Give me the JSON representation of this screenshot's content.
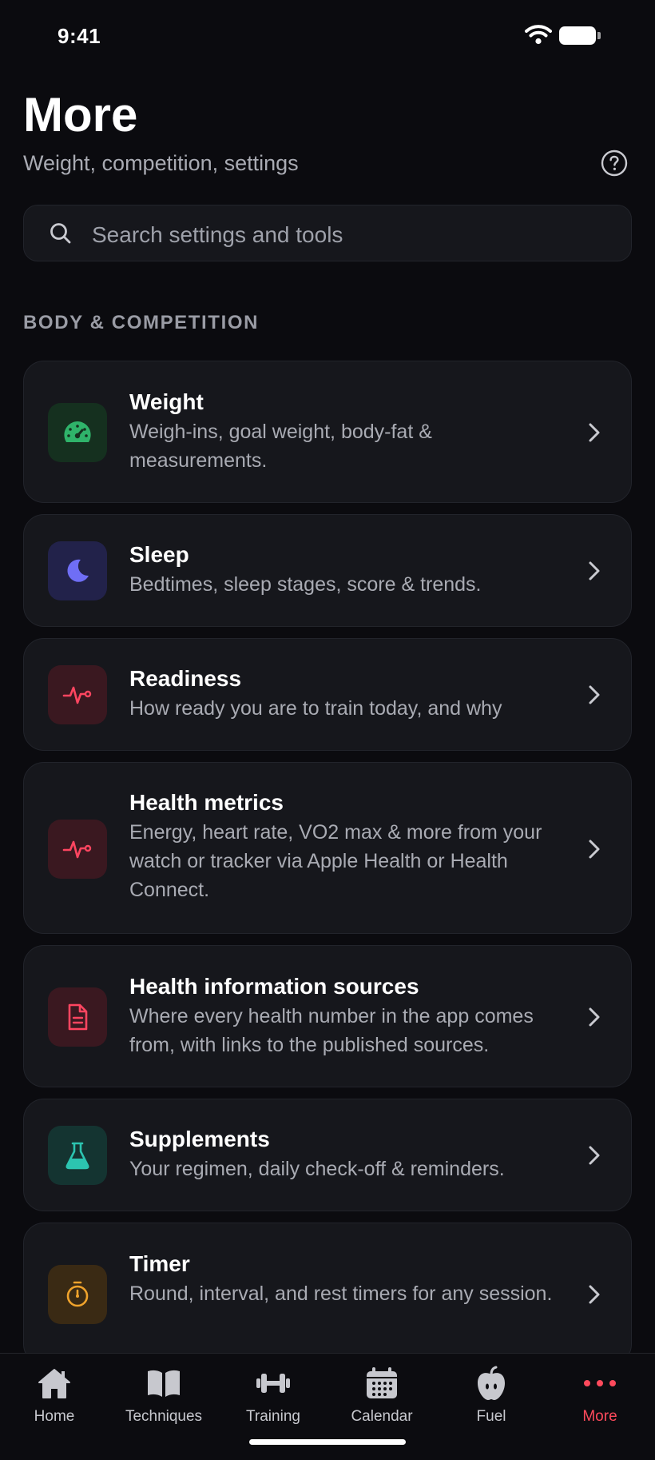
{
  "status_bar": {
    "time": "9:41"
  },
  "header": {
    "title": "More",
    "subtitle": "Weight, competition, settings"
  },
  "search": {
    "placeholder": "Search settings and tools"
  },
  "section": {
    "title": "BODY & COMPETITION"
  },
  "cards": [
    {
      "title": "Weight",
      "description": "Weigh-ins, goal weight, body-fat & measurements.",
      "icon": "gauge-icon",
      "color": "#2fb36a"
    },
    {
      "title": "Sleep",
      "description": "Bedtimes, sleep stages, score & trends.",
      "icon": "moon-icon",
      "color": "#6f6ef5"
    },
    {
      "title": "Readiness",
      "description": "How ready you are to train today, and why",
      "icon": "heartbeat-icon",
      "color": "#ff4560"
    },
    {
      "title": "Health metrics",
      "description": "Energy, heart rate, VO2 max & more from your watch or tracker via Apple Health or Health Connect.",
      "icon": "pulse-icon",
      "color": "#ff4560"
    },
    {
      "title": "Health information sources",
      "description": "Where every health number in the app comes from, with links to the published sources.",
      "icon": "document-icon",
      "color": "#ff4560"
    },
    {
      "title": "Supplements",
      "description": "Your regimen, daily check-off & reminders.",
      "icon": "flask-icon",
      "color": "#2cc4b0"
    },
    {
      "title": "Timer",
      "description": "Round, interval, and rest timers for any session.",
      "icon": "stopwatch-icon",
      "color": "#f0a32c"
    }
  ],
  "tab_bar": {
    "tabs": [
      {
        "label": "Home",
        "icon": "home-icon"
      },
      {
        "label": "Techniques",
        "icon": "book-icon"
      },
      {
        "label": "Training",
        "icon": "dumbbell-icon"
      },
      {
        "label": "Calendar",
        "icon": "calendar-icon"
      },
      {
        "label": "Fuel",
        "icon": "apple-icon"
      },
      {
        "label": "More",
        "icon": "more-dots-icon",
        "active": true
      }
    ],
    "active_color": "#ff4a5c"
  }
}
